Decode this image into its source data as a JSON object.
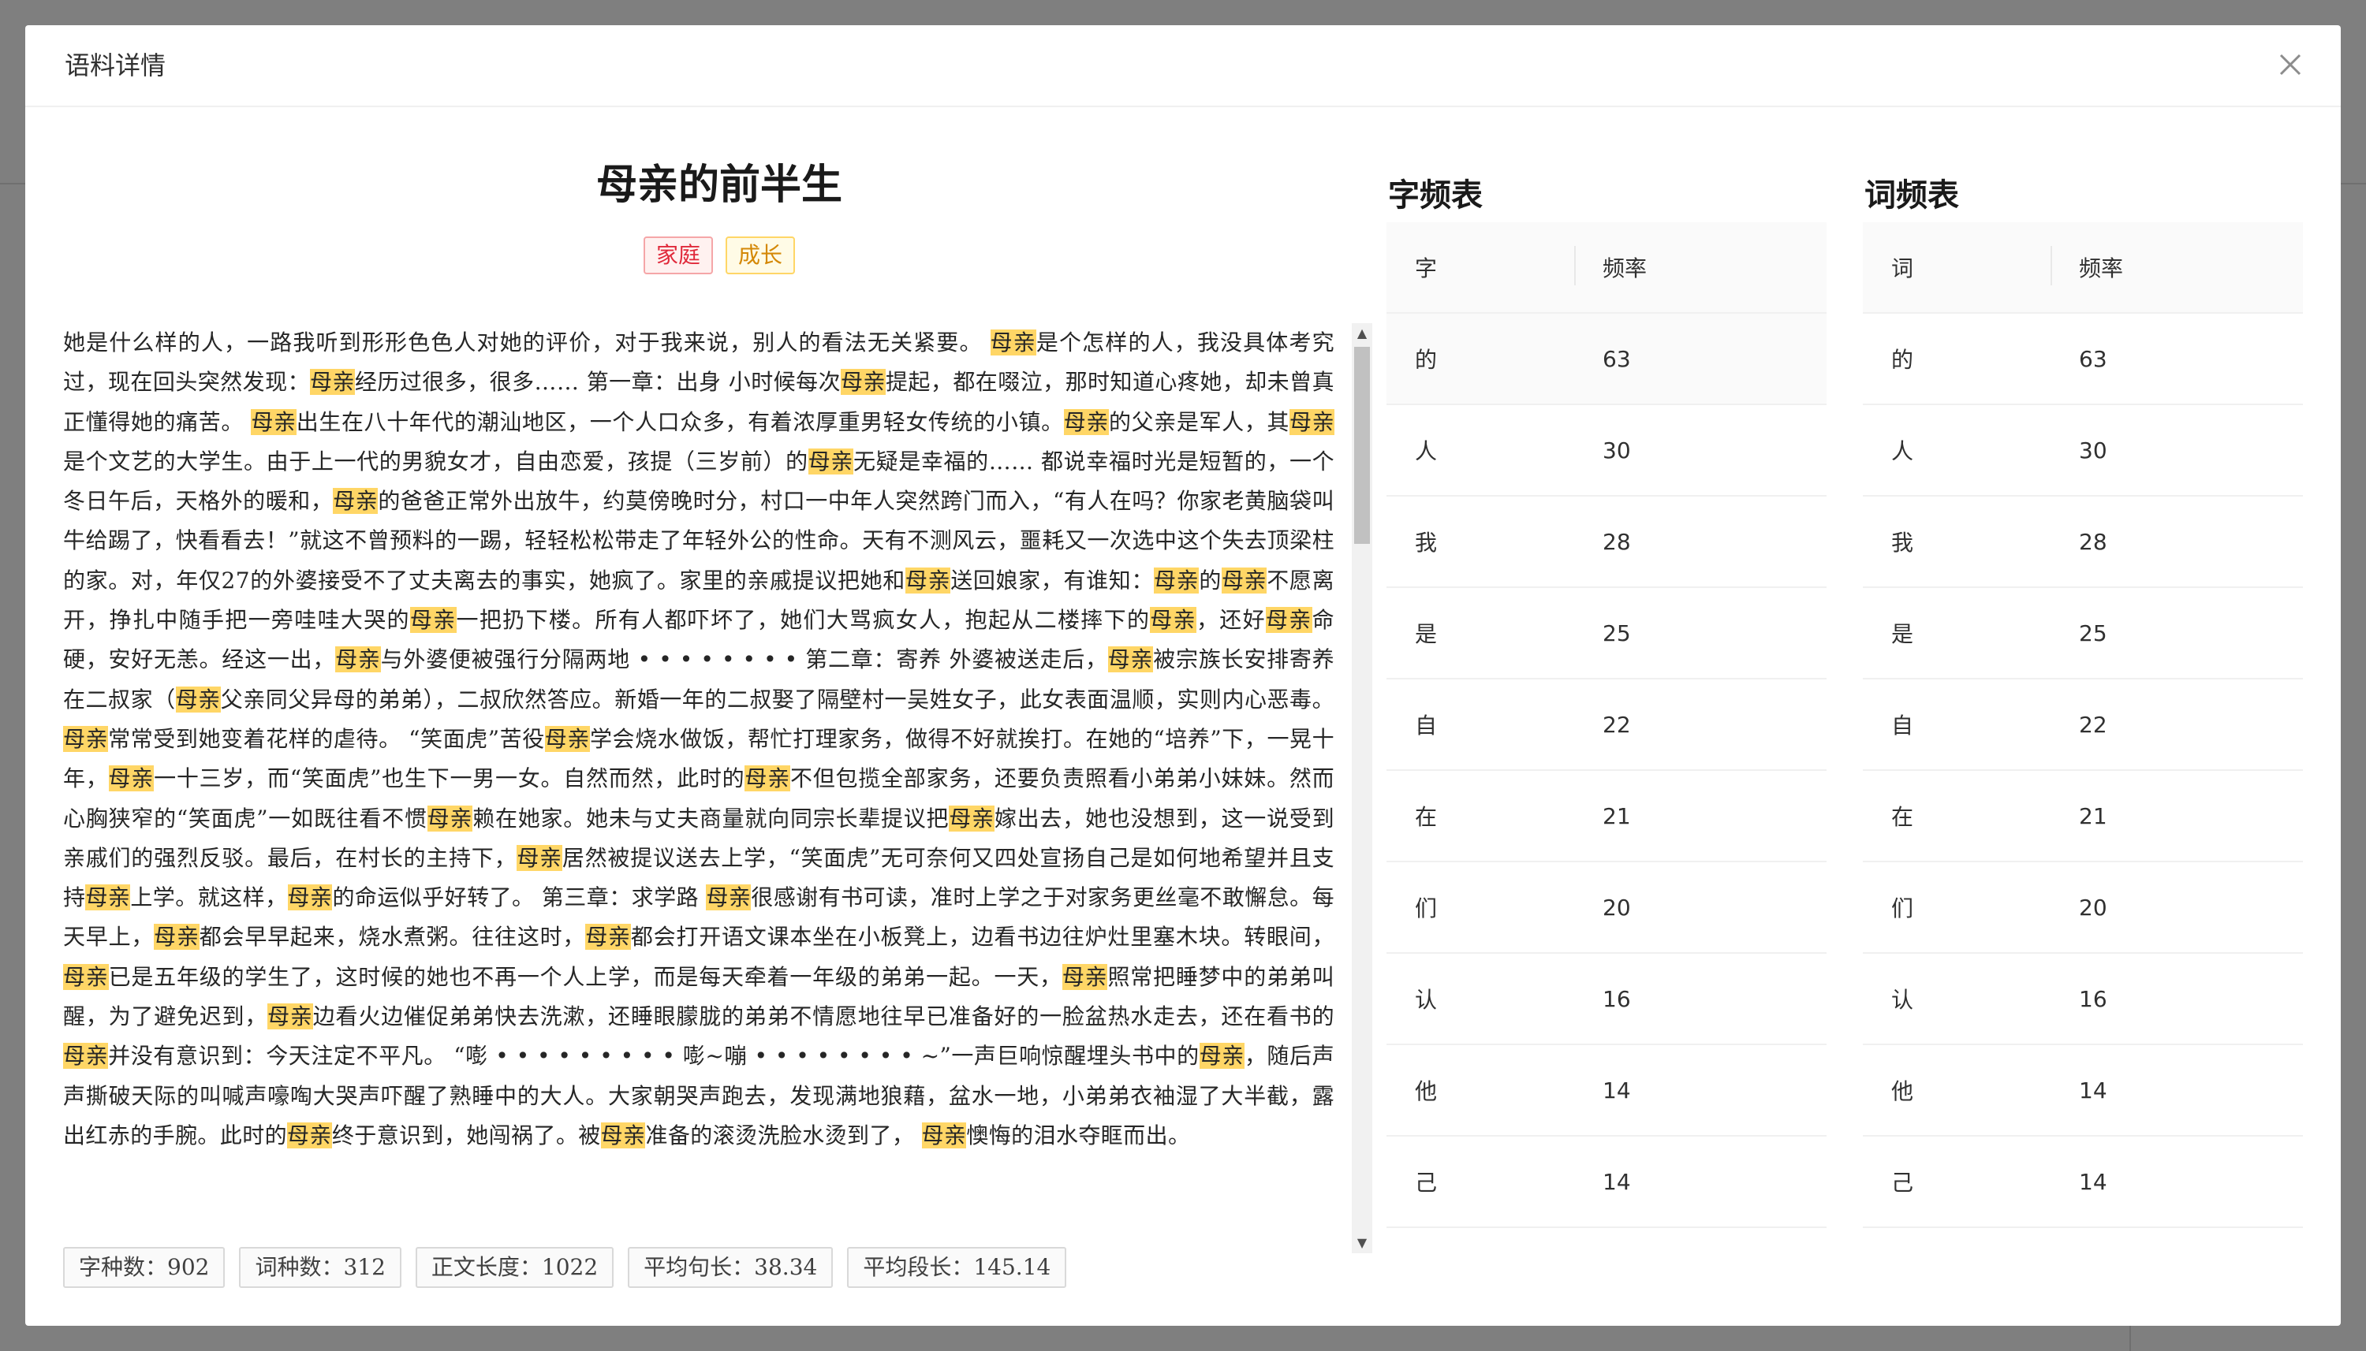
{
  "modal": {
    "title": "语料详情"
  },
  "article": {
    "title": "母亲的前半生",
    "tags": [
      {
        "label": "家庭",
        "color": "#e0293b"
      },
      {
        "label": "成长",
        "color": "#d48806"
      }
    ],
    "highlight_color": "#ffd666",
    "segments": [
      {
        "t": "她是什么样的人，一路我听到形形色色人对她的评价，对于我来说，别人的看法无关紧要。 ",
        "h": false
      },
      {
        "t": "母亲",
        "h": true
      },
      {
        "t": "是个怎样的人，我没具体考究过，现在回头突然发现：",
        "h": false
      },
      {
        "t": "母亲",
        "h": true
      },
      {
        "t": "经历过很多，很多…… 第一章：出身 小时候每次",
        "h": false
      },
      {
        "t": "母亲",
        "h": true
      },
      {
        "t": "提起，都在啜泣，那时知道心疼她，却未曾真正懂得她的痛苦。 ",
        "h": false
      },
      {
        "t": "母亲",
        "h": true
      },
      {
        "t": "出生在八十年代的潮汕地区，一个人口众多，有着浓厚重男轻女传统的小镇。",
        "h": false
      },
      {
        "t": "母亲",
        "h": true
      },
      {
        "t": "的父亲是军人，其",
        "h": false
      },
      {
        "t": "母亲",
        "h": true
      },
      {
        "t": "是个文艺的大学生。由于上一代的男貌女才，自由恋爱，孩提（三岁前）的",
        "h": false
      },
      {
        "t": "母亲",
        "h": true
      },
      {
        "t": "无疑是幸福的…… 都说幸福时光是短暂的，一个冬日午后，天格外的暖和，",
        "h": false
      },
      {
        "t": "母亲",
        "h": true
      },
      {
        "t": "的爸爸正常外出放牛，约莫傍晚时分，村口一中年人突然跨门而入，“有人在吗？你家老黄脑袋叫牛给踢了，快看看去！”就这不曾预料的一踢，轻轻松松带走了年轻外公的性命。天有不测风云，噩耗又一次选中这个失去顶梁柱的家。对，年仅27的外婆接受不了丈夫离去的事实，她疯了。家里的亲戚提议把她和",
        "h": false
      },
      {
        "t": "母亲",
        "h": true
      },
      {
        "t": "送回娘家，有谁知：",
        "h": false
      },
      {
        "t": "母亲",
        "h": true
      },
      {
        "t": "的",
        "h": false
      },
      {
        "t": "母亲",
        "h": true
      },
      {
        "t": "不愿离开，挣扎中随手把一旁哇哇大哭的",
        "h": false
      },
      {
        "t": "母亲",
        "h": true
      },
      {
        "t": "一把扔下楼。所有人都吓坏了，她们大骂疯女人，抱起从二楼摔下的",
        "h": false
      },
      {
        "t": "母亲",
        "h": true
      },
      {
        "t": "，还好",
        "h": false
      },
      {
        "t": "母亲",
        "h": true
      },
      {
        "t": "命硬，安好无恙。经这一出，",
        "h": false
      },
      {
        "t": "母亲",
        "h": true
      },
      {
        "t": "与外婆便被强行分隔两地 • • • • • • • •  第二章：寄养 外婆被送走后，",
        "h": false
      },
      {
        "t": "母亲",
        "h": true
      },
      {
        "t": "被宗族长安排寄养在二叔家（",
        "h": false
      },
      {
        "t": "母亲",
        "h": true
      },
      {
        "t": "父亲同父异母的弟弟），二叔欣然答应。新婚一年的二叔娶了隔壁村一吴姓女子，此女表面温顺，实则内心恶毒。",
        "h": false
      },
      {
        "t": "母亲",
        "h": true
      },
      {
        "t": "常常受到她变着花样的虐待。 “笑面虎”苦役",
        "h": false
      },
      {
        "t": "母亲",
        "h": true
      },
      {
        "t": "学会烧水做饭，帮忙打理家务，做得不好就挨打。在她的“培养”下，一晃十年，",
        "h": false
      },
      {
        "t": "母亲",
        "h": true
      },
      {
        "t": "一十三岁，而“笑面虎”也生下一男一女。自然而然，此时的",
        "h": false
      },
      {
        "t": "母亲",
        "h": true
      },
      {
        "t": "不但包揽全部家务，还要负责照看小弟弟小妹妹。然而心胸狭窄的“笑面虎”一如既往看不惯",
        "h": false
      },
      {
        "t": "母亲",
        "h": true
      },
      {
        "t": "赖在她家。她未与丈夫商量就向同宗长辈提议把",
        "h": false
      },
      {
        "t": "母亲",
        "h": true
      },
      {
        "t": "嫁出去，她也没想到，这一说受到亲戚们的强烈反驳。最后，在村长的主持下，",
        "h": false
      },
      {
        "t": "母亲",
        "h": true
      },
      {
        "t": "居然被提议送去上学，“笑面虎”无可奈何又四处宣扬自己是如何地希望并且支持",
        "h": false
      },
      {
        "t": "母亲",
        "h": true
      },
      {
        "t": "上学。就这样，",
        "h": false
      },
      {
        "t": "母亲",
        "h": true
      },
      {
        "t": "的命运似乎好转了。 第三章：求学路 ",
        "h": false
      },
      {
        "t": "母亲",
        "h": true
      },
      {
        "t": "很感谢有书可读，准时上学之于对家务更丝毫不敢懈怠。每天早上，",
        "h": false
      },
      {
        "t": "母亲",
        "h": true
      },
      {
        "t": "都会早早起来，烧水煮粥。往往这时，",
        "h": false
      },
      {
        "t": "母亲",
        "h": true
      },
      {
        "t": "都会打开语文课本坐在小板凳上，边看书边往炉灶里塞木块。转眼间，",
        "h": false
      },
      {
        "t": "母亲",
        "h": true
      },
      {
        "t": "已是五年级的学生了，这时候的她也不再一个人上学，而是每天牵着一年级的弟弟一起。一天，",
        "h": false
      },
      {
        "t": "母亲",
        "h": true
      },
      {
        "t": "照常把睡梦中的弟弟叫醒，为了避免迟到，",
        "h": false
      },
      {
        "t": "母亲",
        "h": true
      },
      {
        "t": "边看火边催促弟弟快去洗漱，还睡眼朦胧的弟弟不情愿地往早已准备好的一脸盆热水走去，还在看书的",
        "h": false
      },
      {
        "t": "母亲",
        "h": true
      },
      {
        "t": "并没有意识到：今天注定不平凡。 “嘭 • • • • • • • • • 嘭~嘣 • • • • • • • • ~”一声巨响惊醒埋头书中的",
        "h": false
      },
      {
        "t": "母亲",
        "h": true
      },
      {
        "t": "，随后声声撕破天际的叫喊声嚎啕大哭声吓醒了熟睡中的大人。大家朝哭声跑去，发现满地狼藉，盆水一地，小弟弟衣袖湿了大半截，露出红赤的手腕。此时的",
        "h": false
      },
      {
        "t": "母亲",
        "h": true
      },
      {
        "t": "终于意识到，她闯祸了。被",
        "h": false
      },
      {
        "t": "母亲",
        "h": true
      },
      {
        "t": "准备的滚烫洗脸水烫到了， ",
        "h": false
      },
      {
        "t": "母亲",
        "h": true
      },
      {
        "t": "懊悔的泪水夺眶而出。",
        "h": false
      }
    ]
  },
  "stats": [
    "字种数：902",
    "词种数：312",
    "正文长度：1022",
    "平均句长：38.34",
    "平均段长：145.14"
  ],
  "char_freq": {
    "title": "字频表",
    "columns": [
      "字",
      "频率"
    ],
    "rows": [
      [
        "的",
        "63"
      ],
      [
        "人",
        "30"
      ],
      [
        "我",
        "28"
      ],
      [
        "是",
        "25"
      ],
      [
        "自",
        "22"
      ],
      [
        "在",
        "21"
      ],
      [
        "们",
        "20"
      ],
      [
        "认",
        "16"
      ],
      [
        "他",
        "14"
      ],
      [
        "己",
        "14"
      ]
    ]
  },
  "word_freq": {
    "title": "词频表",
    "columns": [
      "词",
      "频率"
    ],
    "rows": [
      [
        "的",
        "63"
      ],
      [
        "人",
        "30"
      ],
      [
        "我",
        "28"
      ],
      [
        "是",
        "25"
      ],
      [
        "自",
        "22"
      ],
      [
        "在",
        "21"
      ],
      [
        "们",
        "20"
      ],
      [
        "认",
        "16"
      ],
      [
        "他",
        "14"
      ],
      [
        "己",
        "14"
      ]
    ]
  }
}
